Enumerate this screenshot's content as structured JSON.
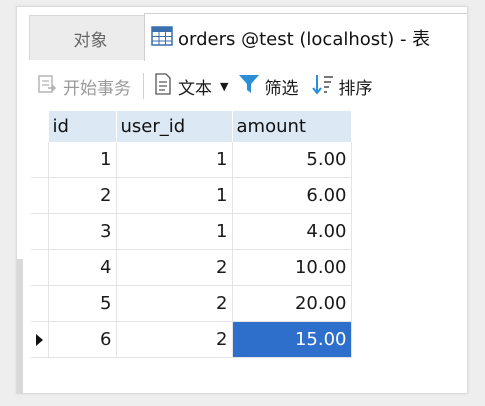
{
  "tabs": {
    "objects_label": "对象",
    "table_tab_label": "orders @test (localhost) - 表"
  },
  "toolbar": {
    "begin_transaction": "开始事务",
    "text": "文本",
    "filter": "筛选",
    "sort": "排序"
  },
  "grid": {
    "columns": [
      "id",
      "user_id",
      "amount"
    ],
    "rows": [
      [
        "1",
        "1",
        "5.00"
      ],
      [
        "2",
        "1",
        "6.00"
      ],
      [
        "3",
        "1",
        "4.00"
      ],
      [
        "4",
        "2",
        "10.00"
      ],
      [
        "5",
        "2",
        "20.00"
      ],
      [
        "6",
        "2",
        "15.00"
      ]
    ]
  },
  "colors": {
    "header_bg": "#dde8f5",
    "selection": "#2e6fcc",
    "filter_icon": "#2b8fd8"
  }
}
